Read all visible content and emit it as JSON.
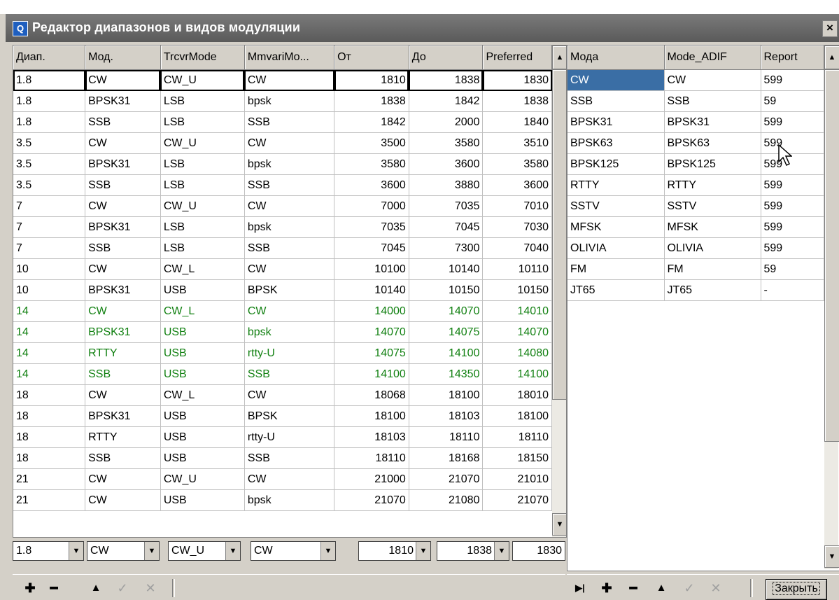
{
  "window": {
    "title": "Редактор диапазонов и видов модуляции",
    "close_glyph": "×",
    "icon_name": "app-icon"
  },
  "left_grid": {
    "columns": [
      "Диап.",
      "Мод.",
      "TrcvrMode",
      "MmvariMo...",
      "От",
      "До",
      "Preferred"
    ],
    "rows": [
      [
        "1.8",
        "CW",
        "CW_U",
        "CW",
        "1810",
        "1838",
        "1830"
      ],
      [
        "1.8",
        "BPSK31",
        "LSB",
        "bpsk",
        "1838",
        "1842",
        "1838"
      ],
      [
        "1.8",
        "SSB",
        "LSB",
        "SSB",
        "1842",
        "2000",
        "1840"
      ],
      [
        "3.5",
        "CW",
        "CW_U",
        "CW",
        "3500",
        "3580",
        "3510"
      ],
      [
        "3.5",
        "BPSK31",
        "LSB",
        "bpsk",
        "3580",
        "3600",
        "3580"
      ],
      [
        "3.5",
        "SSB",
        "LSB",
        "SSB",
        "3600",
        "3880",
        "3600"
      ],
      [
        "7",
        "CW",
        "CW_U",
        "CW",
        "7000",
        "7035",
        "7010"
      ],
      [
        "7",
        "BPSK31",
        "LSB",
        "bpsk",
        "7035",
        "7045",
        "7030"
      ],
      [
        "7",
        "SSB",
        "LSB",
        "SSB",
        "7045",
        "7300",
        "7040"
      ],
      [
        "10",
        "CW",
        "CW_L",
        "CW",
        "10100",
        "10140",
        "10110"
      ],
      [
        "10",
        "BPSK31",
        "USB",
        "BPSK",
        "10140",
        "10150",
        "10150"
      ],
      [
        "14",
        "CW",
        "CW_L",
        "CW",
        "14000",
        "14070",
        "14010"
      ],
      [
        "14",
        "BPSK31",
        "USB",
        "bpsk",
        "14070",
        "14075",
        "14070"
      ],
      [
        "14",
        "RTTY",
        "USB",
        "rtty-U",
        "14075",
        "14100",
        "14080"
      ],
      [
        "14",
        "SSB",
        "USB",
        "SSB",
        "14100",
        "14350",
        "14100"
      ],
      [
        "18",
        "CW",
        "CW_L",
        "CW",
        "18068",
        "18100",
        "18010"
      ],
      [
        "18",
        "BPSK31",
        "USB",
        "BPSK",
        "18100",
        "18103",
        "18100"
      ],
      [
        "18",
        "RTTY",
        "USB",
        "rtty-U",
        "18103",
        "18110",
        "18110"
      ],
      [
        "18",
        "SSB",
        "USB",
        "SSB",
        "18110",
        "18168",
        "18150"
      ],
      [
        "21",
        "CW",
        "CW_U",
        "CW",
        "21000",
        "21070",
        "21010"
      ],
      [
        "21",
        "CW",
        "USB",
        "bpsk",
        "21070",
        "21080",
        "21070"
      ]
    ],
    "highlight_color": "#118011",
    "edit_row": {
      "band": "1.8",
      "mode": "CW",
      "trcvr": "CW_U",
      "mmvari": "CW",
      "from": "1810",
      "to": "1838",
      "preferred": "1830"
    }
  },
  "right_grid": {
    "columns": [
      "Мода",
      "Mode_ADIF",
      "Report"
    ],
    "rows": [
      [
        "CW",
        "CW",
        "599"
      ],
      [
        "SSB",
        "SSB",
        "59"
      ],
      [
        "BPSK31",
        "BPSK31",
        "599"
      ],
      [
        "BPSK63",
        "BPSK63",
        "599"
      ],
      [
        "BPSK125",
        "BPSK125",
        "599"
      ],
      [
        "RTTY",
        "RTTY",
        "599"
      ],
      [
        "SSTV",
        "SSTV",
        "599"
      ],
      [
        "MFSK",
        "MFSK",
        "599"
      ],
      [
        "OLIVIA",
        "OLIVIA",
        "599"
      ],
      [
        "FM",
        "FM",
        "59"
      ],
      [
        "JT65",
        "JT65",
        "-"
      ]
    ],
    "selection_color": "#3a6ea5"
  },
  "left_toolbar": {
    "add": "✚",
    "remove": "━",
    "up": "▲",
    "confirm": "✓",
    "cancel": "✕"
  },
  "right_toolbar": {
    "last": "▶|",
    "add": "✚",
    "remove": "━",
    "up": "▲",
    "confirm": "✓",
    "cancel": "✕",
    "close_label": "Закрыть"
  }
}
